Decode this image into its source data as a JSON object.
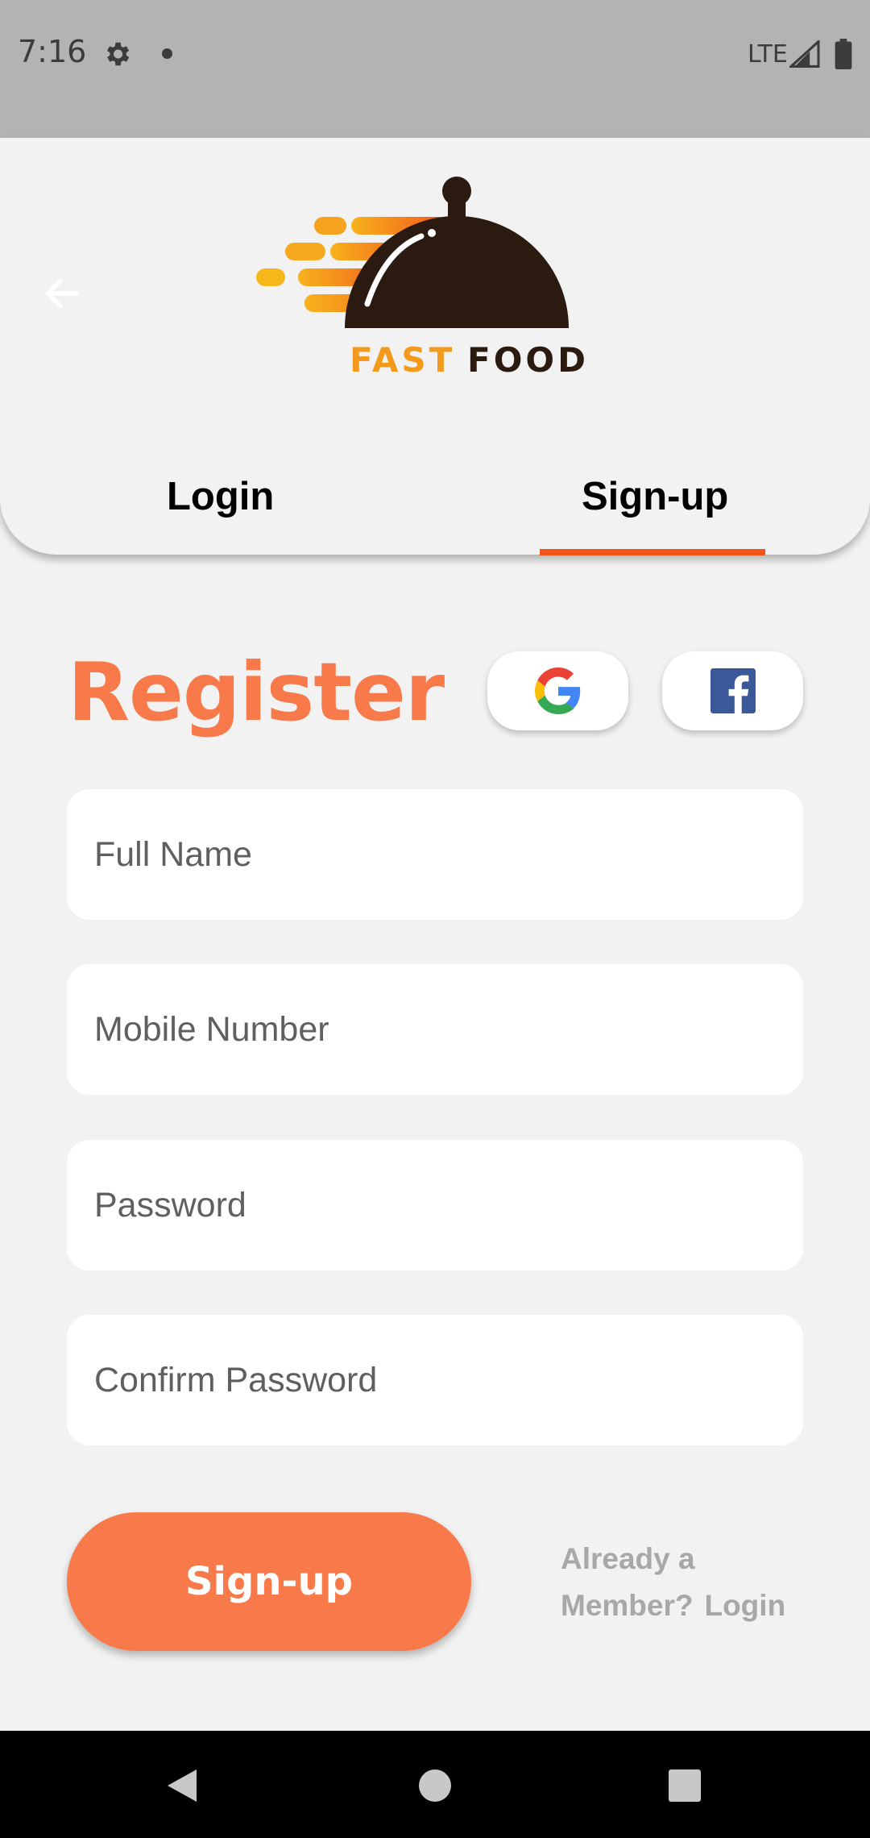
{
  "status_bar": {
    "time": "7:16",
    "network": "LTE",
    "gear_icon": "gear-icon",
    "signal_icon": "signal-icon",
    "battery_icon": "battery-icon"
  },
  "header": {
    "back_icon": "arrow-left-icon",
    "logo": {
      "word1": "FAST",
      "word2": "FOOD",
      "accent_color": "#f39a1d",
      "dark_color": "#2a1a10"
    },
    "tabs": [
      {
        "label": "Login",
        "active": false
      },
      {
        "label": "Sign-up",
        "active": true
      }
    ],
    "indicator_color": "#f2561d"
  },
  "form": {
    "title": "Register",
    "title_color": "#f87a4b",
    "social": [
      {
        "name": "google",
        "icon": "google-icon"
      },
      {
        "name": "facebook",
        "icon": "facebook-icon"
      }
    ],
    "fields": [
      {
        "placeholder": "Full Name",
        "value": ""
      },
      {
        "placeholder": "Mobile Number",
        "value": ""
      },
      {
        "placeholder": "Password",
        "value": ""
      },
      {
        "placeholder": "Confirm Password",
        "value": ""
      }
    ],
    "submit_label": "Sign-up",
    "submit_color": "#f8794a",
    "already_line1": "Already a",
    "already_line2": "Member?",
    "login_link": "Login"
  },
  "nav_bar": {
    "back_icon": "nav-back-icon",
    "home_icon": "nav-home-icon",
    "recents_icon": "nav-recents-icon"
  }
}
